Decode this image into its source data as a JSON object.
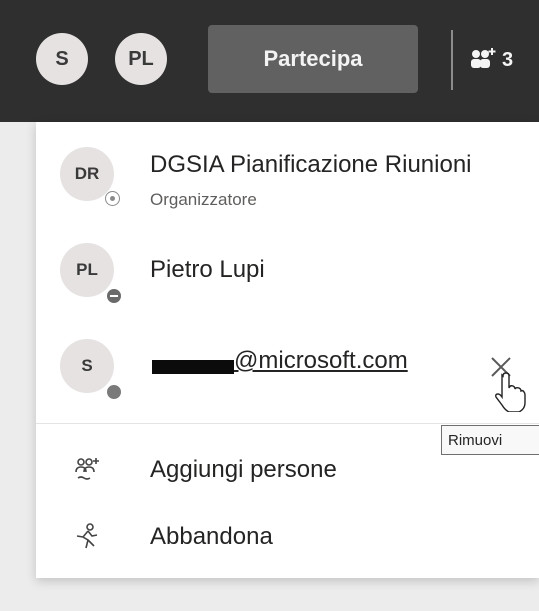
{
  "topbar": {
    "avatars": [
      {
        "initials": "S"
      },
      {
        "initials": "PL"
      }
    ],
    "join_label": "Partecipa",
    "people_count": "3",
    "people_icon": "people-add-icon"
  },
  "participants": [
    {
      "initials": "DR",
      "name": "DGSIA Pianificazione Riunioni",
      "role": "Organizzatore",
      "status": "organizer"
    },
    {
      "initials": "PL",
      "name": "Pietro Lupi",
      "role": "",
      "status": "busy"
    },
    {
      "initials": "S",
      "name": "@microsoft.com",
      "role": "",
      "status": "away"
    }
  ],
  "remove_tooltip": "Rimuovi",
  "actions": [
    {
      "label": "Aggiungi persone",
      "icon": "add-people-icon"
    },
    {
      "label": "Abbandona",
      "icon": "leave-icon"
    }
  ],
  "colors": {
    "topbar_bg": "#2f2f2f",
    "join_button_bg": "#616161",
    "panel_bg": "#ffffff",
    "avatar_bg": "#e6e2e2"
  }
}
